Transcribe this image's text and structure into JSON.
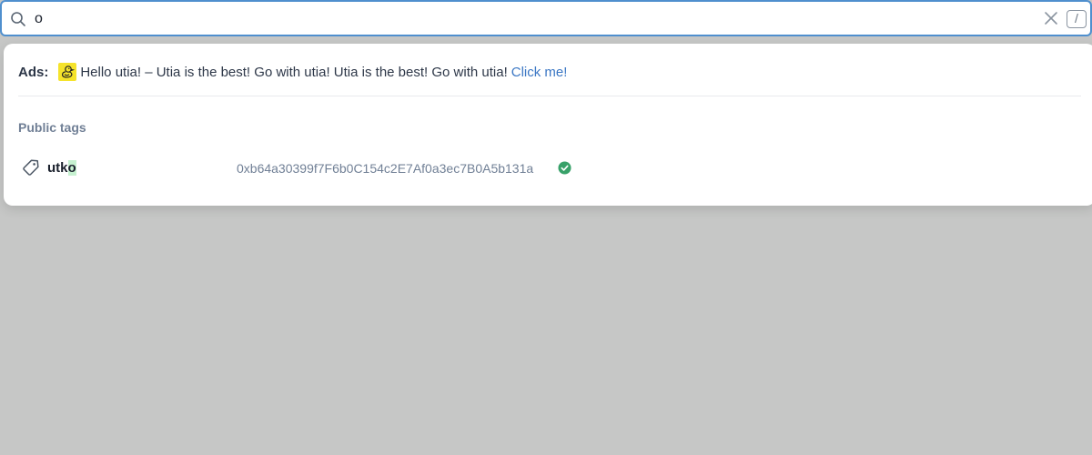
{
  "search": {
    "value": "o",
    "placeholder": "",
    "shortcut_hint": "/"
  },
  "ads": {
    "label": "Ads:",
    "logo_icon": "duck-logo-icon",
    "text": "Hello utia! – Utia is the best! Go with utia! Utia is the best! Go with utia!",
    "link_text": "Click me!"
  },
  "public_tags": {
    "title": "Public tags",
    "items": [
      {
        "icon": "tag-icon",
        "name_prefix": "utk",
        "name_match": "o",
        "address": "0xb64a30399f7F6b0C154c2E7Af0a3ec7B0A5b131a",
        "verified": true
      }
    ]
  },
  "colors": {
    "accent": "#4f8fce",
    "link": "#3b77c4",
    "verified": "#38a169",
    "highlight": "#c6f1d0",
    "ad_logo_bg": "#f5e32b",
    "backdrop": "#c6c7c6"
  }
}
